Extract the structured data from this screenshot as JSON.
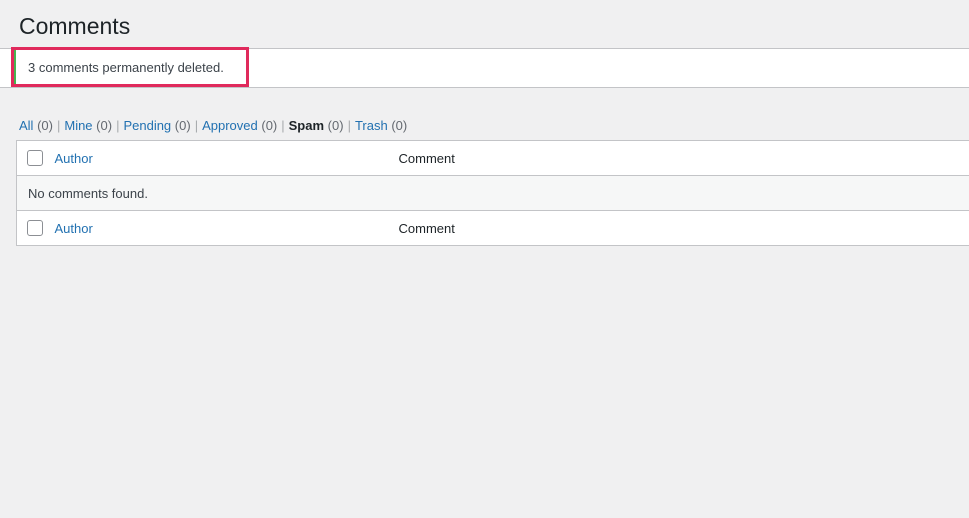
{
  "page": {
    "title": "Comments",
    "background_color": "#f0f0f1"
  },
  "notice": {
    "message": "3 comments permanently deleted.",
    "type": "success",
    "accent_color": "#46b450",
    "background_color": "#ffffff"
  },
  "highlight": {
    "color": "#e02a5c",
    "target": "notice-success-message"
  },
  "filters": {
    "separator": "|",
    "items": [
      {
        "label": "All",
        "count": "(0)",
        "current": false
      },
      {
        "label": "Mine",
        "count": "(0)",
        "current": false
      },
      {
        "label": "Pending",
        "count": "(0)",
        "current": false
      },
      {
        "label": "Approved",
        "count": "(0)",
        "current": false
      },
      {
        "label": "Spam",
        "count": "(0)",
        "current": true
      },
      {
        "label": "Trash",
        "count": "(0)",
        "current": false
      }
    ]
  },
  "table": {
    "columns": {
      "select_all_icon": "checkbox-unchecked-icon",
      "author": "Author",
      "comment": "Comment"
    },
    "empty_message": "No comments found.",
    "rows": []
  },
  "colors": {
    "link": "#2271b1",
    "text": "#3c434a",
    "heading": "#1d2327",
    "muted": "#646970",
    "border": "#c3c4c7",
    "row_alt": "#f6f7f7"
  }
}
